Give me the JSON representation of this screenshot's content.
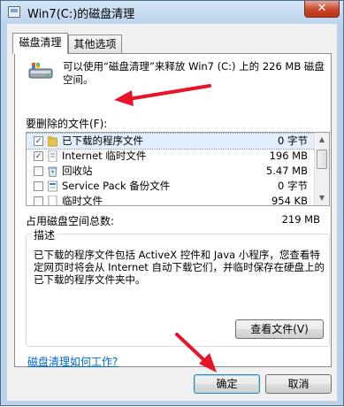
{
  "window": {
    "title": "Win7(C:)的磁盘清理",
    "close_glyph": "✕"
  },
  "tabs": [
    {
      "label": "磁盘清理"
    },
    {
      "label": "其他选项"
    }
  ],
  "intro_text": "可以使用“磁盘清理”来释放 Win7 (C:) 上的 226 MB 磁盘空间。",
  "files_label": "要删除的文件(F):",
  "files": [
    {
      "checked": true,
      "name": "已下载的程序文件",
      "size": "0 字节",
      "icon": "folder-icon"
    },
    {
      "checked": true,
      "name": "Internet 临时文件",
      "size": "196 MB",
      "icon": "document-icon"
    },
    {
      "checked": false,
      "name": "回收站",
      "size": "5.47 MB",
      "icon": "recycle-bin-icon"
    },
    {
      "checked": false,
      "name": "Service Pack 备份文件",
      "size": "0 字节",
      "icon": "backup-icon"
    },
    {
      "checked": false,
      "name": "临时文件",
      "size": "954 KB",
      "icon": "document-icon"
    }
  ],
  "total_label": "占用磁盘空间总数:",
  "total_value": "219 MB",
  "description": {
    "title": "描述",
    "text": "已下载的程序文件包括 ActiveX 控件和 Java 小程序，您查看特定网页时将会从 Internet 自动下载它们，并临时保存在硬盘上的已下载的程序文件夹中。"
  },
  "view_files_button": "查看文件(V)",
  "help_link": "磁盘清理如何工作?",
  "ok_button": "确定",
  "cancel_button": "取消",
  "colors": {
    "annotation_arrow": "#e8142a",
    "window_frame": "#bcd2ea",
    "link": "#0066cc"
  }
}
